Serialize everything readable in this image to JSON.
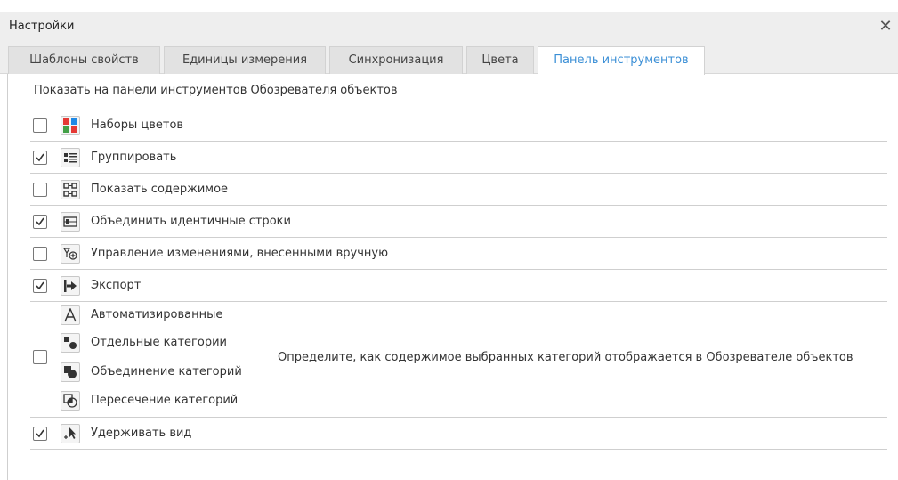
{
  "dialog": {
    "title": "Настройки",
    "close_glyph": "✕"
  },
  "tabs": [
    {
      "label": "Шаблоны свойств",
      "active": false
    },
    {
      "label": "Единицы измерения",
      "active": false
    },
    {
      "label": "Синхронизация",
      "active": false
    },
    {
      "label": "Цвета",
      "active": false
    },
    {
      "label": "Панель инструментов",
      "active": true
    }
  ],
  "section_heading": "Показать на панели инструментов Обозревателя объектов",
  "options": [
    {
      "label": "Наборы цветов",
      "checked": false,
      "icon": "color-sets-icon"
    },
    {
      "label": "Группировать",
      "checked": true,
      "icon": "group-icon"
    },
    {
      "label": "Показать содержимое",
      "checked": false,
      "icon": "show-content-icon"
    },
    {
      "label": "Объединить идентичные строки",
      "checked": true,
      "icon": "merge-rows-icon"
    },
    {
      "label": "Управление изменениями, внесенными вручную",
      "checked": false,
      "icon": "manual-changes-icon"
    },
    {
      "label": "Экспорт",
      "checked": true,
      "icon": "export-icon"
    }
  ],
  "category_group": {
    "checked": false,
    "items": [
      {
        "label": "Автоматизированные",
        "icon": "automated-icon"
      },
      {
        "label": "Отдельные категории",
        "icon": "separate-categories-icon"
      },
      {
        "label": "Объединение категорий",
        "icon": "union-categories-icon"
      },
      {
        "label": "Пересечение категорий",
        "icon": "intersection-categories-icon"
      }
    ],
    "description": "Определите, как содержимое выбранных категорий отображается в Обозревателе объектов"
  },
  "keep_view": {
    "label": "Удерживать вид",
    "checked": true,
    "icon": "keep-view-icon"
  },
  "colors": {
    "accent": "#3b8fd6",
    "title_bg": "#eeeeee",
    "divider": "#cfcfcf"
  }
}
